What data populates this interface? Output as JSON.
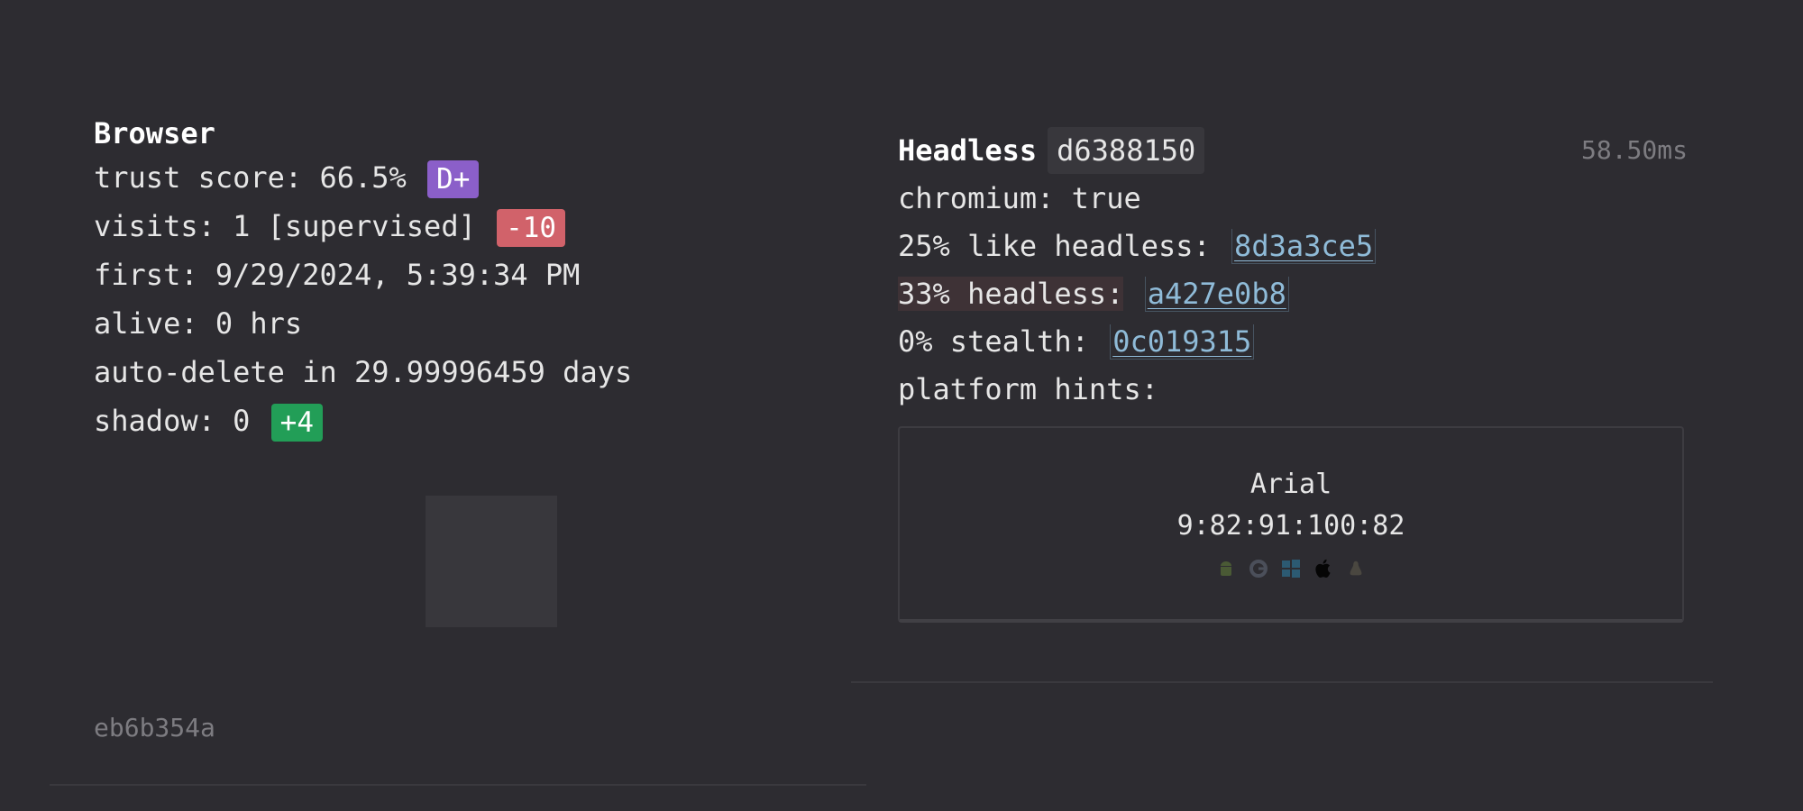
{
  "browser": {
    "title": "Browser",
    "trust_label": "trust score: 66.5%",
    "trust_grade": "D+",
    "visits_label": "visits: 1 [supervised]",
    "visits_delta": "-10",
    "first_seen": "first: 9/29/2024, 5:39:34 PM",
    "alive": "alive: 0 hrs",
    "auto_delete": "auto-delete in 29.99996459 days",
    "shadow_label": "shadow: 0",
    "shadow_delta": "+4",
    "hash": "eb6b354a"
  },
  "headless": {
    "title": "Headless",
    "hash": "d6388150",
    "timing": "58.50ms",
    "chromium": "chromium: true",
    "like_headless_label": "25% like headless:",
    "like_headless_hash": "8d3a3ce5",
    "headless_label": "33% headless:",
    "headless_hash": "a427e0b8",
    "stealth_label": "0% stealth:",
    "stealth_hash": "0c019315",
    "platform_hints_label": "platform hints:",
    "hint_font": "Arial",
    "hint_values": "9:82:91:100:82",
    "platform_icons": [
      "android-icon",
      "google-icon",
      "windows-icon",
      "apple-icon",
      "linux-icon"
    ]
  },
  "colors": {
    "background": "#2d2c31",
    "grade_badge": "#8b5fc9",
    "negative_badge": "#d1626a",
    "positive_badge": "#229e57",
    "link": "#8fbbd8",
    "muted": "#7d7c81"
  }
}
